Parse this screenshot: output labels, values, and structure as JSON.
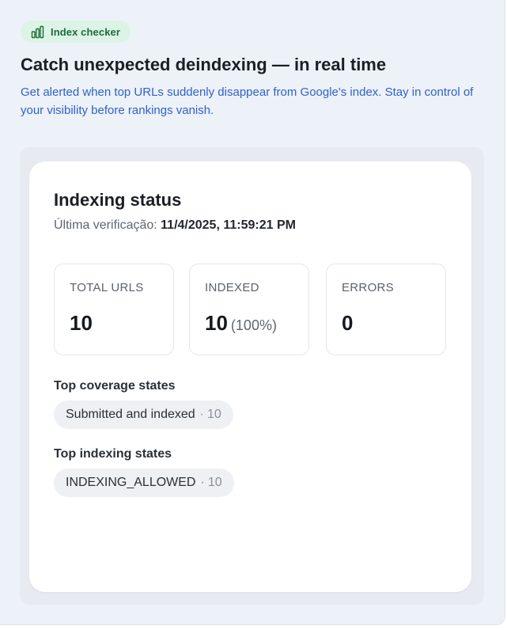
{
  "header": {
    "badge_label": "Index checker",
    "badge_icon": "bar-chart-icon",
    "badge_color": "#1f6b3a",
    "badge_bg": "#dcf4e5",
    "headline": "Catch unexpected deindexing — in real time",
    "description": "Get alerted when top URLs suddenly disappear from Google's index. Stay in control of your visibility before rankings vanish.",
    "description_color": "#2f62c8"
  },
  "status_card": {
    "title": "Indexing status",
    "last_check_label": "Última verificação:",
    "last_check_value": "11/4/2025, 11:59:21 PM",
    "stats": [
      {
        "label": "TOTAL URLS",
        "value": "10",
        "extra": ""
      },
      {
        "label": "INDEXED",
        "value": "10",
        "extra": "(100%)"
      },
      {
        "label": "ERRORS",
        "value": "0",
        "extra": ""
      }
    ],
    "coverage": {
      "label": "Top coverage states",
      "items": [
        {
          "name": "Submitted and indexed",
          "sep": "·",
          "count": "10"
        }
      ]
    },
    "indexing": {
      "label": "Top indexing states",
      "items": [
        {
          "name": "INDEXING_ALLOWED",
          "sep": "·",
          "count": "10"
        }
      ]
    }
  }
}
